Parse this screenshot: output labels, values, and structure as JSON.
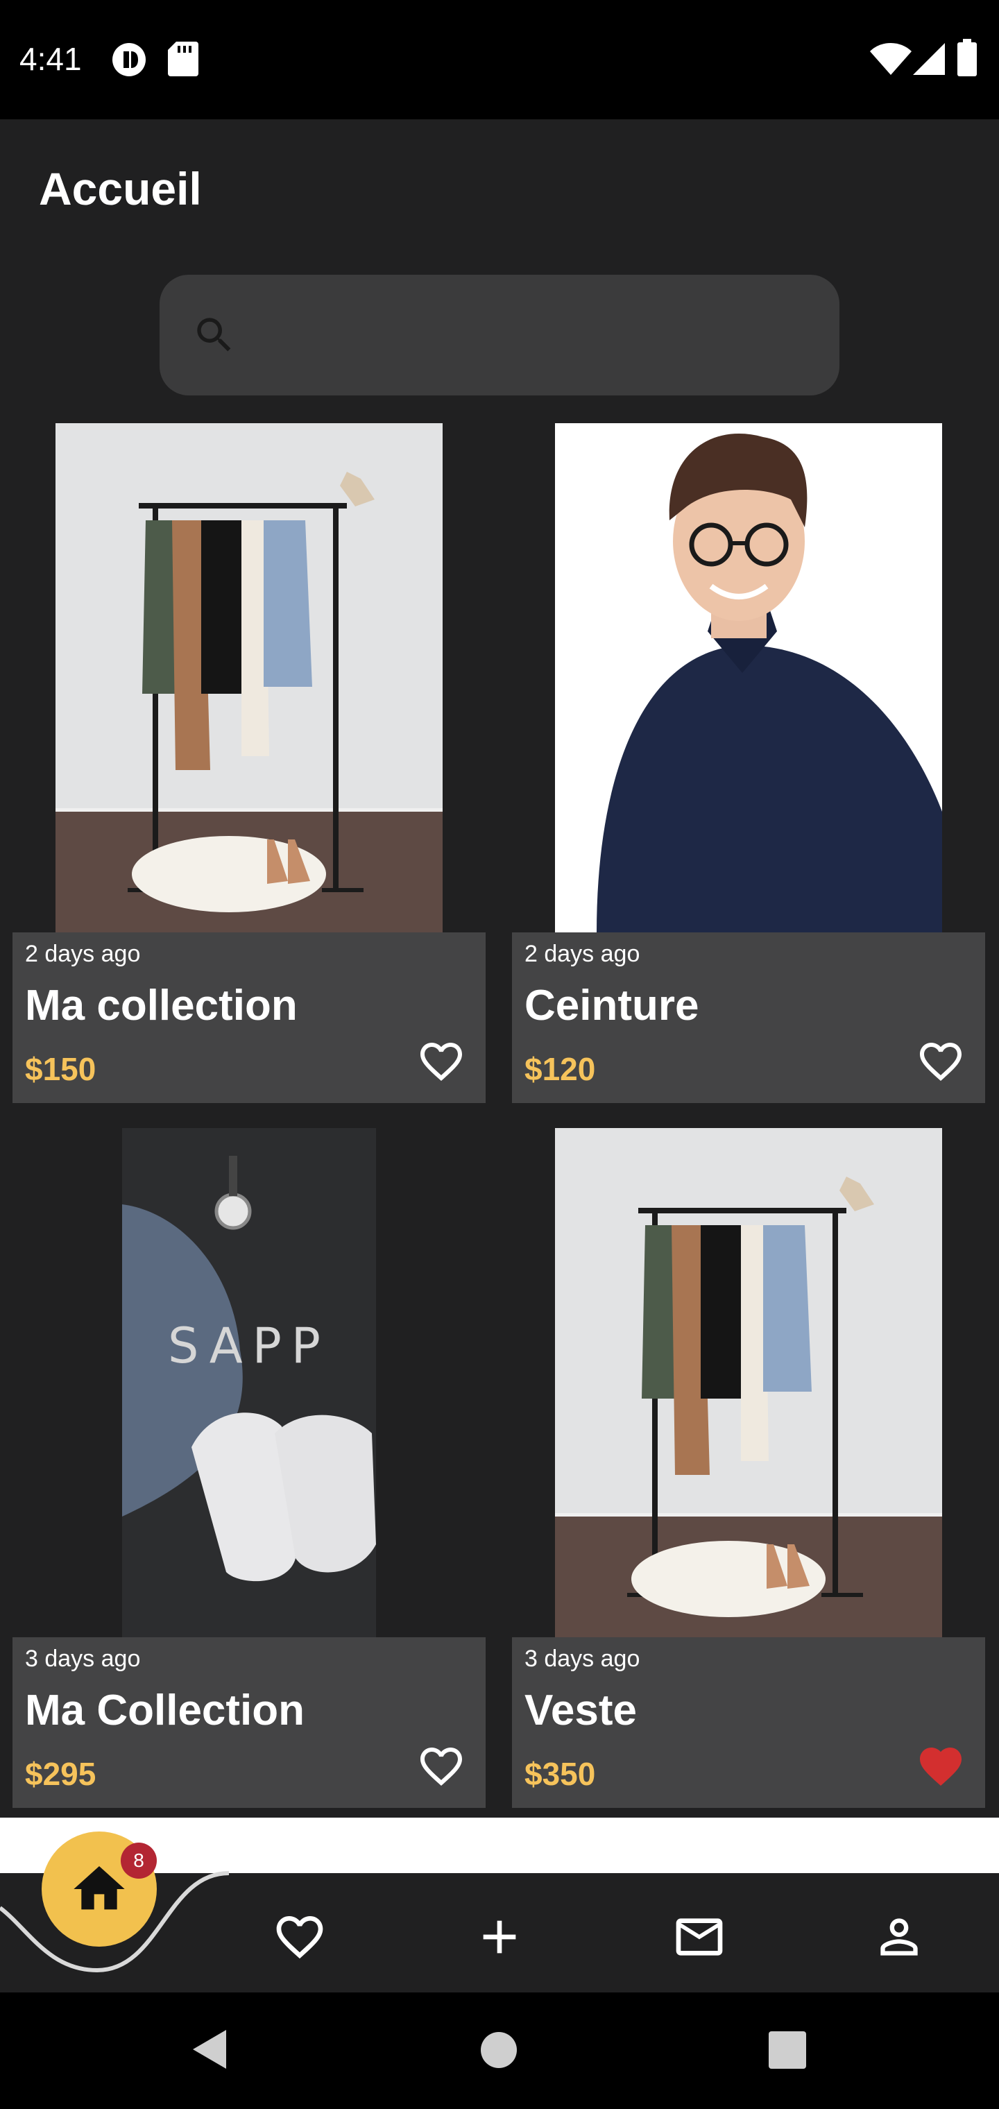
{
  "status_bar": {
    "time": "4:41",
    "icons": [
      "app-notification-icon",
      "sd-card-icon",
      "wifi-icon",
      "cell-signal-icon",
      "battery-icon"
    ]
  },
  "header": {
    "title": "Accueil"
  },
  "search": {
    "placeholder": "",
    "icon": "search-icon"
  },
  "products": [
    {
      "time_ago": "2 days ago",
      "name": "Ma collection",
      "price": "$150",
      "favorited": false,
      "image": "clothes-rack-photo"
    },
    {
      "time_ago": "2 days ago",
      "name": "Ceinture",
      "price": "$120",
      "favorited": false,
      "image": "man-portrait-photo"
    },
    {
      "time_ago": "3 days ago",
      "name": "Ma Collection",
      "price": "$295",
      "favorited": false,
      "image": "sapp-jeans-sneakers-photo",
      "image_text": "SAPP"
    },
    {
      "time_ago": "3 days ago",
      "name": "Veste",
      "price": "$350",
      "favorited": true,
      "image": "clothes-rack-photo"
    }
  ],
  "bottom_nav": {
    "badge_count": "8",
    "items": [
      "home-icon",
      "heart-icon",
      "plus-icon",
      "mail-icon",
      "person-icon"
    ]
  },
  "colors": {
    "background": "#202021",
    "card_info": "#444445",
    "price": "#f6c35b",
    "accent_home": "#f2c14e",
    "favorite_active": "#d32f2f",
    "badge": "#b32633"
  }
}
